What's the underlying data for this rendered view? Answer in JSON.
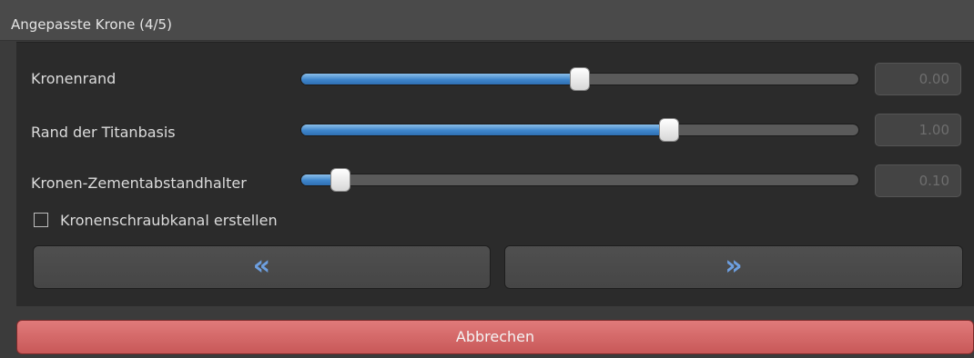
{
  "header": {
    "title": "Angepasste Krone (4/5)"
  },
  "sliders": [
    {
      "label": "Kronenrand",
      "value": "0.00",
      "level": 0.5
    },
    {
      "label": "Rand der Titanbasis",
      "value": "1.00",
      "level": 0.66
    },
    {
      "label": "Kronen-Zementabstandhalter",
      "value": "0.10",
      "level": 0.07
    }
  ],
  "options": {
    "screw_channel_label": "Kronenschraubkanal erstellen",
    "screw_channel_checked": false
  },
  "nav": {
    "back_label": "«",
    "next_label": "»"
  },
  "actions": {
    "cancel_label": "Abbrechen"
  },
  "colors": {
    "accent": "#3e86cc",
    "cancel": "#d66a6a",
    "arrow": "#6d9fe0"
  }
}
